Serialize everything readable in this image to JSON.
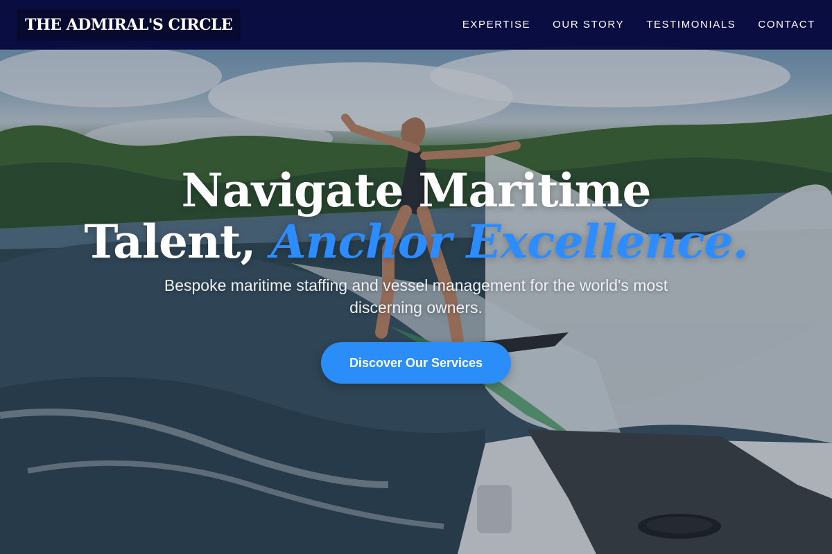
{
  "brand": {
    "logo_text": "THE ADMIRAL'S CIRCLE"
  },
  "nav": {
    "items": [
      {
        "label": "EXPERTISE"
      },
      {
        "label": "OUR STORY"
      },
      {
        "label": "TESTIMONIALS"
      },
      {
        "label": "CONTACT"
      }
    ]
  },
  "hero": {
    "headline_line1": "Navigate Maritime",
    "headline_line2_plain": "Talent, ",
    "headline_line2_accent": "Anchor Excellence.",
    "subheadline": "Bespoke maritime staffing and vessel management for the world's most discerning owners.",
    "cta_label": "Discover Our Services",
    "background_image": "wakeboarder-on-lake-photo"
  },
  "colors": {
    "nav_background": "#05073c",
    "accent": "#2d8cff",
    "cta_background": "#2b8df7",
    "text": "#ffffff"
  }
}
